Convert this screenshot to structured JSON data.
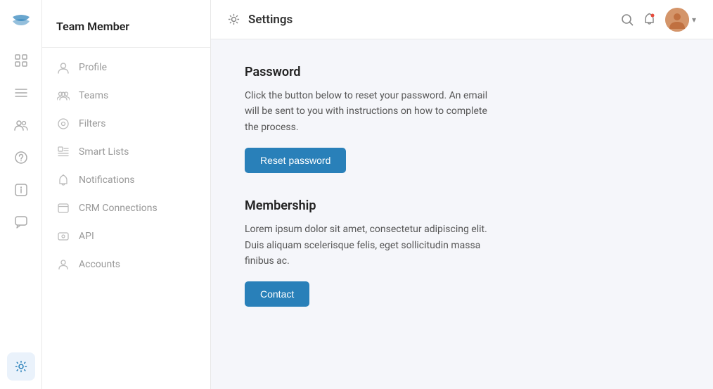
{
  "app": {
    "logo_label": "App Logo"
  },
  "header": {
    "title": "Settings",
    "search_label": "Search",
    "notifications_label": "Notifications",
    "avatar_label": "User Avatar",
    "chevron_label": "Expand"
  },
  "sidebar": {
    "title": "Team Member",
    "items": [
      {
        "id": "profile",
        "label": "Profile",
        "icon": "person-icon"
      },
      {
        "id": "teams",
        "label": "Teams",
        "icon": "teams-icon"
      },
      {
        "id": "filters",
        "label": "Filters",
        "icon": "filters-icon"
      },
      {
        "id": "smart-lists",
        "label": "Smart Lists",
        "icon": "smart-lists-icon"
      },
      {
        "id": "notifications",
        "label": "Notifications",
        "icon": "notifications-icon"
      },
      {
        "id": "crm-connections",
        "label": "CRM Connections",
        "icon": "crm-icon"
      },
      {
        "id": "api",
        "label": "API",
        "icon": "api-icon"
      },
      {
        "id": "accounts",
        "label": "Accounts",
        "icon": "accounts-icon"
      }
    ]
  },
  "rail": {
    "icons": [
      {
        "id": "grid",
        "label": "Grid icon"
      },
      {
        "id": "list",
        "label": "List icon"
      },
      {
        "id": "people",
        "label": "People icon"
      },
      {
        "id": "help",
        "label": "Help icon"
      },
      {
        "id": "info",
        "label": "Info icon"
      },
      {
        "id": "chat",
        "label": "Chat icon"
      },
      {
        "id": "settings",
        "label": "Settings icon"
      }
    ]
  },
  "content": {
    "password_section": {
      "title": "Password",
      "description": "Click the button below to reset your password. An email will be sent to you with instructions on how to complete the process.",
      "button_label": "Reset password"
    },
    "membership_section": {
      "title": "Membership",
      "description": "Lorem ipsum dolor sit amet, consectetur adipiscing elit. Duis aliquam scelerisque felis, eget sollicitudin massa finibus ac.",
      "button_label": "Contact"
    }
  }
}
